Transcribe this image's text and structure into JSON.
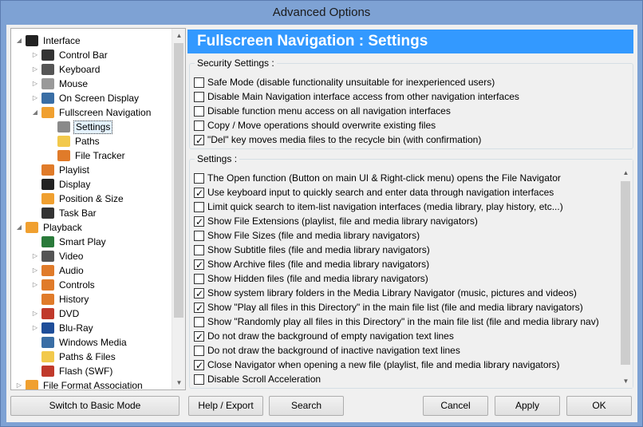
{
  "window": {
    "title": "Advanced Options"
  },
  "tree": {
    "items": [
      {
        "label": "Interface",
        "level": 0,
        "arrow": "down",
        "icon": "monitor-icon",
        "color": "#222"
      },
      {
        "label": "Control Bar",
        "level": 1,
        "arrow": "right",
        "icon": "control-bar-icon",
        "color": "#333"
      },
      {
        "label": "Keyboard",
        "level": 1,
        "arrow": "right",
        "icon": "keyboard-icon",
        "color": "#555"
      },
      {
        "label": "Mouse",
        "level": 1,
        "arrow": "right",
        "icon": "mouse-icon",
        "color": "#999"
      },
      {
        "label": "On Screen Display",
        "level": 1,
        "arrow": "right",
        "icon": "osd-icon",
        "color": "#3a6ea5"
      },
      {
        "label": "Fullscreen Navigation",
        "level": 1,
        "arrow": "down",
        "icon": "fullscreen-icon",
        "color": "#f0a030"
      },
      {
        "label": "Settings",
        "level": 2,
        "arrow": "",
        "icon": "gear-icon",
        "color": "#8a8a8a",
        "selected": true
      },
      {
        "label": "Paths",
        "level": 2,
        "arrow": "",
        "icon": "folder-icon",
        "color": "#f2c94c"
      },
      {
        "label": "File Tracker",
        "level": 2,
        "arrow": "",
        "icon": "file-tracker-icon",
        "color": "#e07b2a"
      },
      {
        "label": "Playlist",
        "level": 1,
        "arrow": "",
        "icon": "playlist-icon",
        "color": "#e07b2a"
      },
      {
        "label": "Display",
        "level": 1,
        "arrow": "",
        "icon": "display-icon",
        "color": "#222"
      },
      {
        "label": "Position & Size",
        "level": 1,
        "arrow": "",
        "icon": "position-icon",
        "color": "#f0a030"
      },
      {
        "label": "Task Bar",
        "level": 1,
        "arrow": "",
        "icon": "taskbar-icon",
        "color": "#333"
      },
      {
        "label": "Playback",
        "level": 0,
        "arrow": "down",
        "icon": "play-icon",
        "color": "#f0a030"
      },
      {
        "label": "Smart Play",
        "level": 1,
        "arrow": "",
        "icon": "smart-play-icon",
        "color": "#2a7a3a"
      },
      {
        "label": "Video",
        "level": 1,
        "arrow": "right",
        "icon": "video-icon",
        "color": "#555"
      },
      {
        "label": "Audio",
        "level": 1,
        "arrow": "right",
        "icon": "audio-icon",
        "color": "#e07b2a"
      },
      {
        "label": "Controls",
        "level": 1,
        "arrow": "right",
        "icon": "controls-icon",
        "color": "#e07b2a"
      },
      {
        "label": "History",
        "level": 1,
        "arrow": "",
        "icon": "history-icon",
        "color": "#e07b2a"
      },
      {
        "label": "DVD",
        "level": 1,
        "arrow": "right",
        "icon": "dvd-icon",
        "color": "#c0392b"
      },
      {
        "label": "Blu-Ray",
        "level": 1,
        "arrow": "right",
        "icon": "bluray-icon",
        "color": "#1f4e99"
      },
      {
        "label": "Windows Media",
        "level": 1,
        "arrow": "",
        "icon": "windows-media-icon",
        "color": "#3a6ea5"
      },
      {
        "label": "Paths & Files",
        "level": 1,
        "arrow": "",
        "icon": "folder-icon",
        "color": "#f2c94c"
      },
      {
        "label": "Flash (SWF)",
        "level": 1,
        "arrow": "",
        "icon": "flash-icon",
        "color": "#c0392b"
      },
      {
        "label": "File Format Association",
        "level": 0,
        "arrow": "right",
        "icon": "file-assoc-icon",
        "color": "#f0a030"
      }
    ]
  },
  "panel": {
    "title": "Fullscreen Navigation : Settings",
    "header_color": "#3399ff",
    "security": {
      "title": "Security Settings :",
      "items": [
        {
          "label": "Safe Mode (disable functionality unsuitable for inexperienced users)",
          "checked": false
        },
        {
          "label": "Disable Main Navigation interface access from other navigation interfaces",
          "checked": false
        },
        {
          "label": "Disable function menu access on all navigation interfaces",
          "checked": false
        },
        {
          "label": "Copy / Move operations should overwrite existing files",
          "checked": false
        },
        {
          "label": "\"Del\" key moves media files to the recycle bin (with confirmation)",
          "checked": true
        }
      ]
    },
    "settings": {
      "title": "Settings :",
      "items": [
        {
          "label": "The Open function (Button on main UI & Right-click menu) opens the File Navigator",
          "checked": false
        },
        {
          "label": "Use keyboard input to quickly search and enter data through navigation interfaces",
          "checked": true
        },
        {
          "label": "Limit quick search to item-list navigation interfaces (media library, play history, etc...)",
          "checked": false
        },
        {
          "label": "Show File Extensions (playlist, file and media library navigators)",
          "checked": true
        },
        {
          "label": "Show File Sizes (file and media library navigators)",
          "checked": false
        },
        {
          "label": "Show Subtitle files (file and media library navigators)",
          "checked": false
        },
        {
          "label": "Show Archive files (file and media library navigators)",
          "checked": true
        },
        {
          "label": "Show Hidden files (file and media library navigators)",
          "checked": false
        },
        {
          "label": "Show system library folders in the Media Library Navigator (music, pictures and videos)",
          "checked": true
        },
        {
          "label": "Show \"Play all files in this Directory\" in the main file list (file and media library navigators)",
          "checked": true
        },
        {
          "label": "Show \"Randomly play all files in this Directory\" in the main file list (file and media library nav)",
          "checked": false
        },
        {
          "label": "Do not draw the background of empty navigation text lines",
          "checked": true
        },
        {
          "label": "Do not draw the background of inactive navigation text lines",
          "checked": false
        },
        {
          "label": "Close Navigator when opening a new file (playlist, file and media library navigators)",
          "checked": true
        },
        {
          "label": "Disable Scroll Acceleration",
          "checked": false
        }
      ]
    }
  },
  "buttons": {
    "basic_mode": "Switch to Basic Mode",
    "help": "Help / Export",
    "search": "Search",
    "cancel": "Cancel",
    "apply": "Apply",
    "ok": "OK"
  }
}
